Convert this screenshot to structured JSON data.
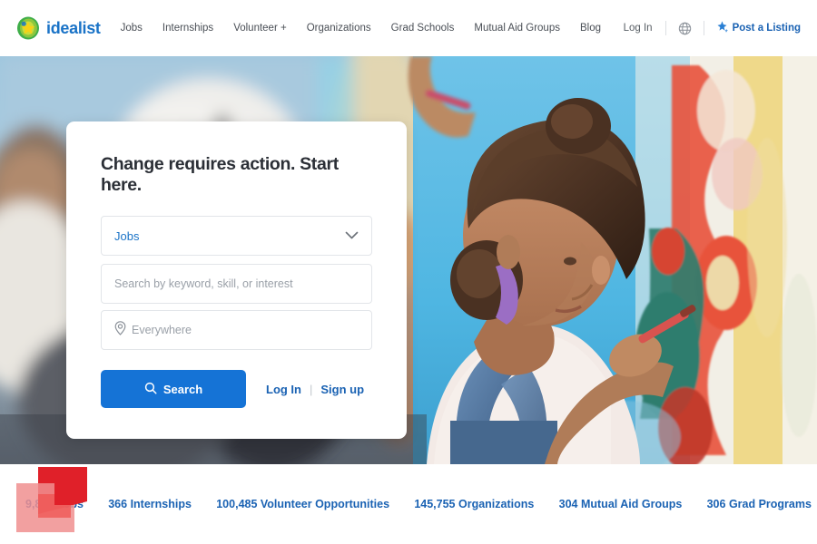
{
  "brand": {
    "name": "idealist",
    "logo_icon": "idealist-blob-logo",
    "colors": {
      "text": "#1a73c7",
      "outer": "#57b947",
      "mid": "#8cc63f",
      "inner": "#f5d020"
    }
  },
  "header": {
    "nav_items": [
      {
        "label": "Jobs",
        "name": "jobs"
      },
      {
        "label": "Internships",
        "name": "internships"
      },
      {
        "label": "Volunteer +",
        "name": "volunteer"
      },
      {
        "label": "Organizations",
        "name": "organizations"
      },
      {
        "label": "Grad Schools",
        "name": "grad-schools"
      },
      {
        "label": "Mutual Aid Groups",
        "name": "mutual-aid-groups"
      },
      {
        "label": "Blog",
        "name": "blog"
      }
    ],
    "login_label": "Log In",
    "language_icon": "globe-icon",
    "post_listing_label": "Post a Listing",
    "post_listing_icon": "sparkle-star-icon"
  },
  "hero": {
    "alt": "girl painting a colorful mural on a wall",
    "accent": "#1573d6"
  },
  "search_card": {
    "title": "Change requires action. Start here.",
    "category": {
      "value": "Jobs",
      "icon": "chevron-down-icon"
    },
    "keyword": {
      "value": "",
      "placeholder": "Search by keyword, skill, or interest"
    },
    "location": {
      "value": "",
      "placeholder": "Everywhere",
      "icon": "map-pin-icon"
    },
    "search_button": {
      "label": "Search",
      "icon": "search-icon"
    },
    "login_label": "Log In",
    "separator": "|",
    "signup_label": "Sign up"
  },
  "stats": [
    {
      "label": "9,828 Jobs",
      "name": "jobs"
    },
    {
      "label": "366 Internships",
      "name": "internships"
    },
    {
      "label": "100,485 Volunteer Opportunities",
      "name": "volunteer-opportunities"
    },
    {
      "label": "145,755 Organizations",
      "name": "organizations"
    },
    {
      "label": "304 Mutual Aid Groups",
      "name": "mutual-aid-groups"
    },
    {
      "label": "306 Grad Programs",
      "name": "grad-programs"
    }
  ],
  "overlay": {
    "icon": "red-ribbon-badge",
    "color": "#e8242e"
  }
}
